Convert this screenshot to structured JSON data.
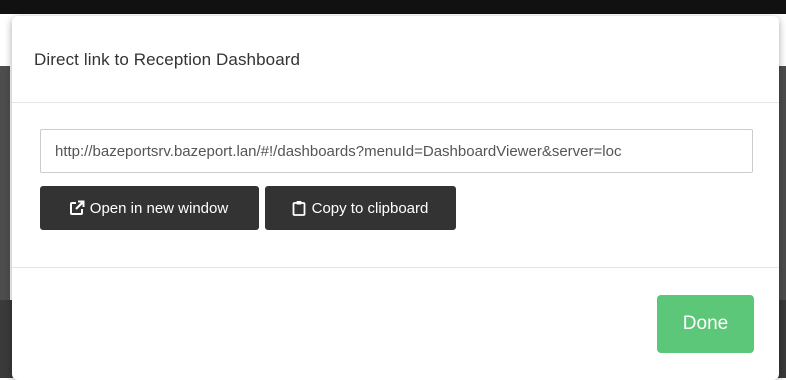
{
  "modal": {
    "title": "Direct link to Reception Dashboard",
    "link_value": "http://bazeportsrv.bazeport.lan/#!/dashboards?menuId=DashboardViewer&server=loc",
    "open_button_label": "Open in new window",
    "copy_button_label": "Copy to clipboard",
    "done_button_label": "Done",
    "open_icon": "external-link-icon",
    "copy_icon": "clipboard-icon"
  },
  "colors": {
    "done_button": "#5cc679",
    "dark_button": "#333333",
    "title_text": "#333333"
  }
}
